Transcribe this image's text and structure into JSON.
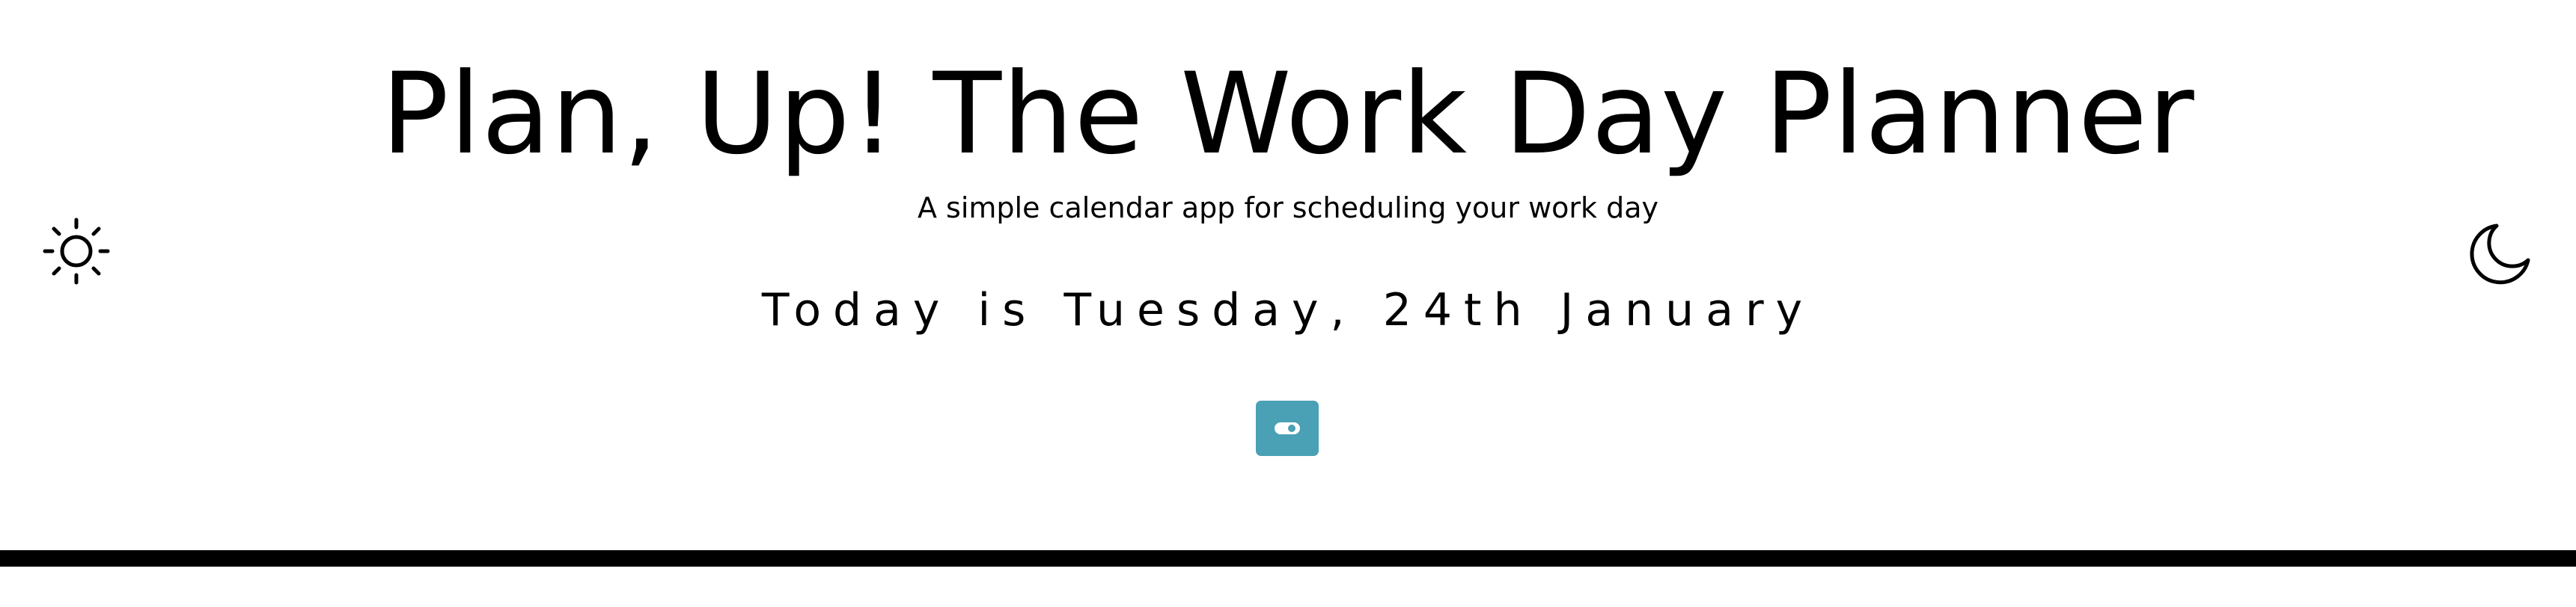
{
  "header": {
    "title": "Plan, Up! The Work Day Planner",
    "subtitle": "A simple calendar app for scheduling your work day",
    "date_text": "Today is Tuesday, 24th January"
  },
  "icons": {
    "light_mode": "sun-icon",
    "dark_mode": "moon-icon",
    "toggle": "toggle-switch-icon"
  },
  "colors": {
    "toggle_button": "#4aa0b5",
    "divider": "#000000",
    "background": "#ffffff",
    "text": "#000000"
  }
}
